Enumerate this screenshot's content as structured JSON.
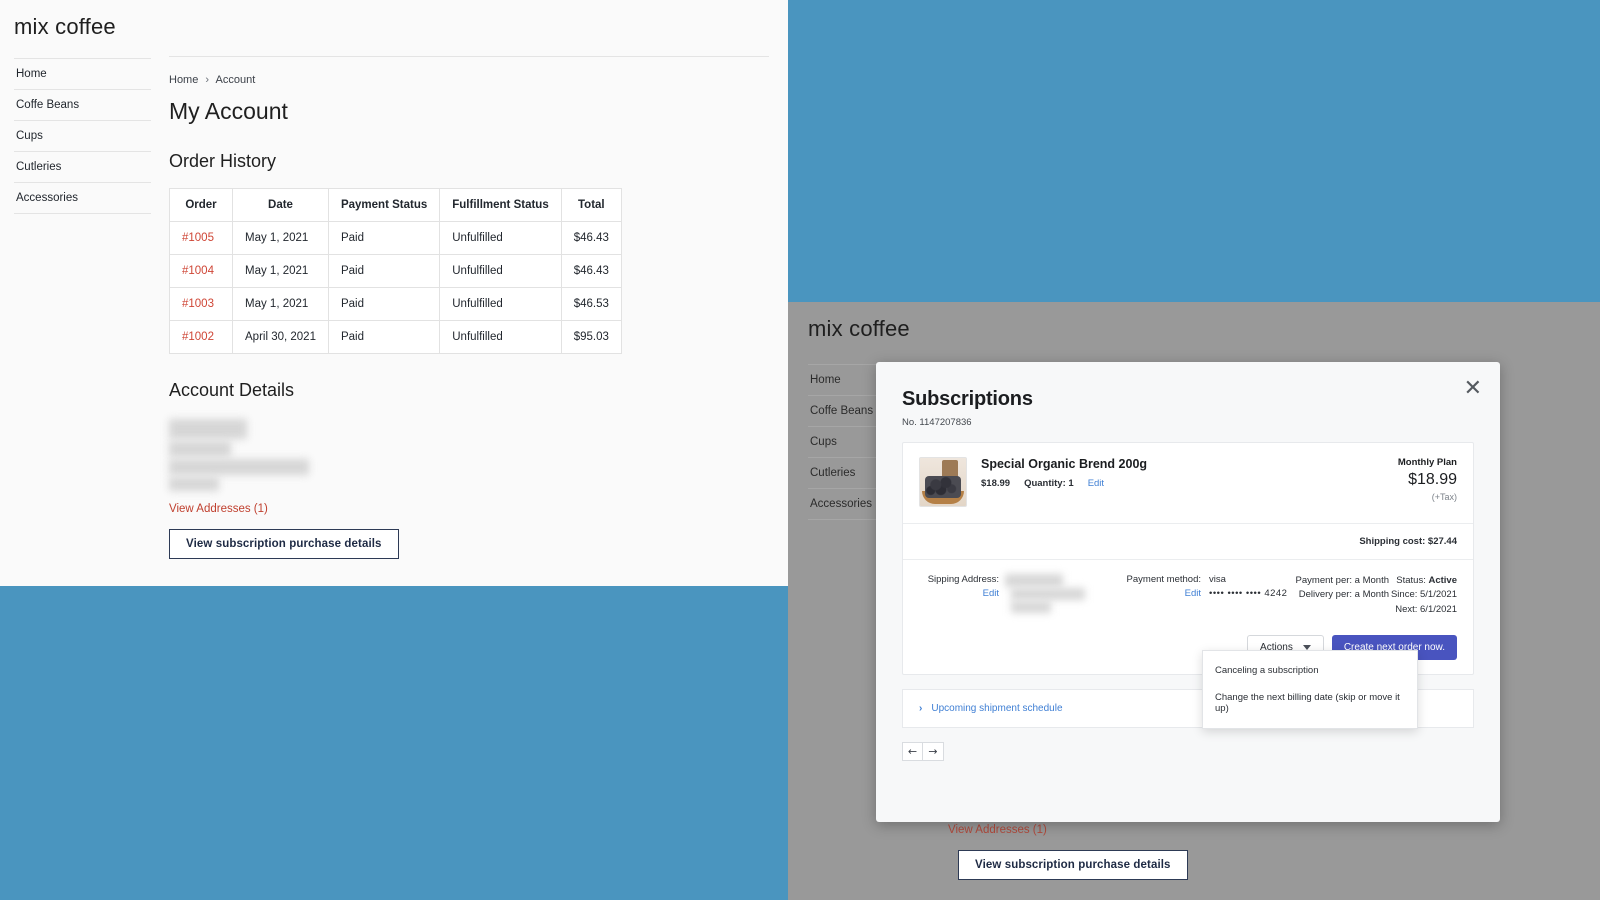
{
  "site": {
    "logo": "mix coffee",
    "nav": [
      "Home",
      "Coffe Beans",
      "Cups",
      "Cutleries",
      "Accessories"
    ]
  },
  "account_page": {
    "breadcrumb": {
      "home": "Home",
      "separator": "›",
      "current": "Account"
    },
    "page_title": "My Account",
    "order_history_title": "Order History",
    "orders_table": {
      "columns": [
        "Order",
        "Date",
        "Payment Status",
        "Fulfillment Status",
        "Total"
      ],
      "rows": [
        [
          "#1005",
          "May 1, 2021",
          "Paid",
          "Unfulfilled",
          "$46.43"
        ],
        [
          "#1004",
          "May 1, 2021",
          "Paid",
          "Unfulfilled",
          "$46.43"
        ],
        [
          "#1003",
          "May 1, 2021",
          "Paid",
          "Unfulfilled",
          "$46.53"
        ],
        [
          "#1002",
          "April 30, 2021",
          "Paid",
          "Unfulfilled",
          "$95.03"
        ]
      ]
    },
    "account_details_title": "Account Details",
    "view_addresses": "View Addresses (1)",
    "subscription_button": "View subscription purchase details"
  },
  "modal": {
    "title": "Subscriptions",
    "number": "No. 1147207836",
    "close_label": "✕",
    "product": {
      "name": "Special Organic Brend 200g",
      "price": "$18.99",
      "quantity": "Quantity: 1",
      "edit": "Edit",
      "plan_name": "Monthly Plan",
      "plan_price": "$18.99",
      "tax_note": "(+Tax)"
    },
    "shipping_cost": "Shipping cost: $27.44",
    "details": {
      "shipping_label": "Sipping Address:",
      "shipping_edit": "Edit",
      "payment_label": "Payment method:",
      "payment_edit": "Edit",
      "payment_brand": "visa",
      "payment_card": "•••• •••• •••• 4242",
      "payment_per": "Payment per: a Month",
      "delivery_per": "Delivery per: a Month",
      "status_label": "Status:",
      "status_value": "Active",
      "since": "Since: 5/1/2021",
      "next": "Next: 6/1/2021"
    },
    "actions_button": "Actions",
    "primary_button": "Create next order now.",
    "dropdown_items": [
      "Canceling a subscription",
      "Change the next billing date (skip or move it up)"
    ],
    "shipment_schedule": "Upcoming shipment schedule",
    "pager": {
      "prev": "←",
      "next": "→"
    }
  },
  "colors": {
    "accent_blue": "#4a95bf",
    "link_red": "#c0402f",
    "primary_button": "#4954bf",
    "link_blue": "#3f7fd4",
    "overlay_gray": "#999999"
  }
}
